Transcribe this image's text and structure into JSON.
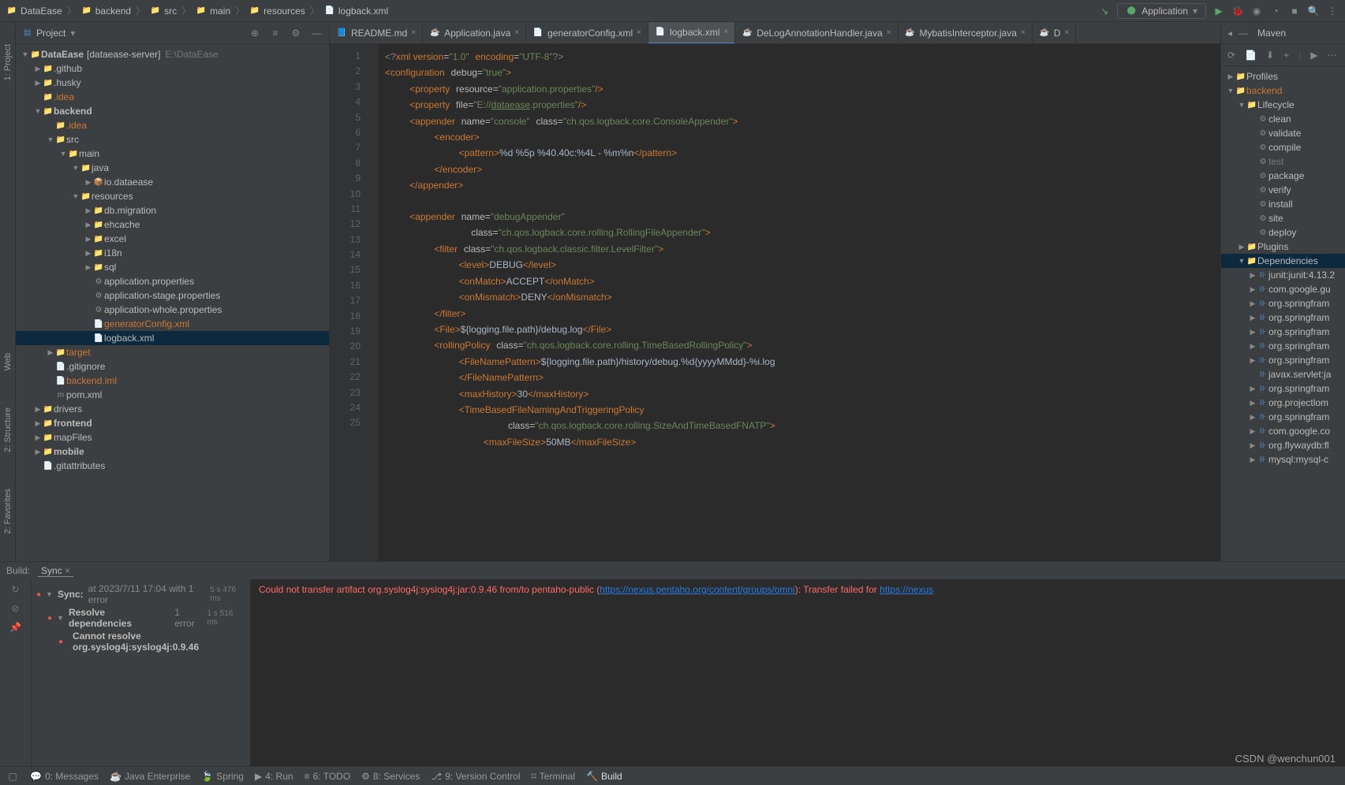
{
  "breadcrumb": [
    "DataEase",
    "backend",
    "src",
    "main",
    "resources",
    "logback.xml"
  ],
  "run_config": "Application",
  "project_panel_title": "Project",
  "project_root": {
    "name": "DataEase",
    "module": "[dataease-server]",
    "path": "E:\\DataEase"
  },
  "tree": [
    {
      "d": 1,
      "a": "▶",
      "i": "📁",
      "t": ".github"
    },
    {
      "d": 1,
      "a": "▶",
      "i": "📁",
      "t": ".husky"
    },
    {
      "d": 1,
      "a": "",
      "i": "📁",
      "t": ".idea",
      "cls": "orange"
    },
    {
      "d": 1,
      "a": "▼",
      "i": "📁",
      "t": "backend",
      "bold": true
    },
    {
      "d": 2,
      "a": "",
      "i": "📁",
      "t": ".idea",
      "cls": "orange"
    },
    {
      "d": 2,
      "a": "▼",
      "i": "📁",
      "t": "src",
      "blue": true
    },
    {
      "d": 3,
      "a": "▼",
      "i": "📁",
      "t": "main"
    },
    {
      "d": 4,
      "a": "▼",
      "i": "📁",
      "t": "java",
      "blue": true
    },
    {
      "d": 5,
      "a": "▶",
      "i": "📦",
      "t": "io.dataease"
    },
    {
      "d": 4,
      "a": "▼",
      "i": "📁",
      "t": "resources"
    },
    {
      "d": 5,
      "a": "▶",
      "i": "📁",
      "t": "db.migration"
    },
    {
      "d": 5,
      "a": "▶",
      "i": "📁",
      "t": "ehcache"
    },
    {
      "d": 5,
      "a": "▶",
      "i": "📁",
      "t": "excel"
    },
    {
      "d": 5,
      "a": "▶",
      "i": "📁",
      "t": "i18n"
    },
    {
      "d": 5,
      "a": "▶",
      "i": "📁",
      "t": "sql"
    },
    {
      "d": 5,
      "a": "",
      "i": "⚙",
      "t": "application.properties"
    },
    {
      "d": 5,
      "a": "",
      "i": "⚙",
      "t": "application-stage.properties"
    },
    {
      "d": 5,
      "a": "",
      "i": "⚙",
      "t": "application-whole.properties"
    },
    {
      "d": 5,
      "a": "",
      "i": "📄",
      "t": "generatorConfig.xml",
      "cls": "orange"
    },
    {
      "d": 5,
      "a": "",
      "i": "📄",
      "t": "logback.xml",
      "sel": true
    },
    {
      "d": 2,
      "a": "▶",
      "i": "📁",
      "t": "target",
      "cls": "orange",
      "orange": true
    },
    {
      "d": 2,
      "a": "",
      "i": "📄",
      "t": ".gitignore"
    },
    {
      "d": 2,
      "a": "",
      "i": "📄",
      "t": "backend.iml",
      "cls": "orange"
    },
    {
      "d": 2,
      "a": "",
      "i": "m",
      "t": "pom.xml"
    },
    {
      "d": 1,
      "a": "▶",
      "i": "📁",
      "t": "drivers"
    },
    {
      "d": 1,
      "a": "▶",
      "i": "📁",
      "t": "frontend",
      "bold": true
    },
    {
      "d": 1,
      "a": "▶",
      "i": "📁",
      "t": "mapFiles"
    },
    {
      "d": 1,
      "a": "▶",
      "i": "📁",
      "t": "mobile",
      "bold": true
    },
    {
      "d": 1,
      "a": "",
      "i": "📄",
      "t": ".gitattributes"
    }
  ],
  "editor_tabs": [
    {
      "icon": "📘",
      "label": "README.md"
    },
    {
      "icon": "☕",
      "label": "Application.java"
    },
    {
      "icon": "📄",
      "label": "generatorConfig.xml"
    },
    {
      "icon": "📄",
      "label": "logback.xml",
      "active": true
    },
    {
      "icon": "☕",
      "label": "DeLogAnnotationHandler.java"
    },
    {
      "icon": "☕",
      "label": "MybatisInterceptor.java"
    },
    {
      "icon": "☕",
      "label": "D"
    }
  ],
  "code_lines": 25,
  "maven_title": "Maven",
  "maven_tree": [
    {
      "d": 0,
      "a": "▶",
      "t": "Profiles"
    },
    {
      "d": 0,
      "a": "▼",
      "t": "backend",
      "cls": "orange"
    },
    {
      "d": 1,
      "a": "▼",
      "t": "Lifecycle"
    },
    {
      "d": 2,
      "a": "",
      "t": "clean",
      "g": true
    },
    {
      "d": 2,
      "a": "",
      "t": "validate",
      "g": true
    },
    {
      "d": 2,
      "a": "",
      "t": "compile",
      "g": true
    },
    {
      "d": 2,
      "a": "",
      "t": "test",
      "g": true,
      "dim": true
    },
    {
      "d": 2,
      "a": "",
      "t": "package",
      "g": true
    },
    {
      "d": 2,
      "a": "",
      "t": "verify",
      "g": true
    },
    {
      "d": 2,
      "a": "",
      "t": "install",
      "g": true
    },
    {
      "d": 2,
      "a": "",
      "t": "site",
      "g": true
    },
    {
      "d": 2,
      "a": "",
      "t": "deploy",
      "g": true
    },
    {
      "d": 1,
      "a": "▶",
      "t": "Plugins"
    },
    {
      "d": 1,
      "a": "▼",
      "t": "Dependencies",
      "sel": true
    },
    {
      "d": 2,
      "a": "▶",
      "t": "junit:junit:4.13.2",
      "lib": true
    },
    {
      "d": 2,
      "a": "▶",
      "t": "com.google.gu",
      "lib": true
    },
    {
      "d": 2,
      "a": "▶",
      "t": "org.springfram",
      "lib": true
    },
    {
      "d": 2,
      "a": "▶",
      "t": "org.springfram",
      "lib": true
    },
    {
      "d": 2,
      "a": "▶",
      "t": "org.springfram",
      "lib": true
    },
    {
      "d": 2,
      "a": "▶",
      "t": "org.springfram",
      "lib": true
    },
    {
      "d": 2,
      "a": "▶",
      "t": "org.springfram",
      "lib": true
    },
    {
      "d": 2,
      "a": "",
      "t": "javax.servlet:ja",
      "lib": true
    },
    {
      "d": 2,
      "a": "▶",
      "t": "org.springfram",
      "lib": true
    },
    {
      "d": 2,
      "a": "▶",
      "t": "org.projectlom",
      "lib": true
    },
    {
      "d": 2,
      "a": "▶",
      "t": "org.springfram",
      "lib": true
    },
    {
      "d": 2,
      "a": "▶",
      "t": "com.google.co",
      "lib": true
    },
    {
      "d": 2,
      "a": "▶",
      "t": "org.flywaydb:fl",
      "lib": true
    },
    {
      "d": 2,
      "a": "▶",
      "t": "mysql:mysql-c",
      "lib": true
    }
  ],
  "build_tab_label": "Build:",
  "build_sync_tab": "Sync",
  "build_tree": [
    {
      "d": 0,
      "ic": "err",
      "t": "Sync:",
      "sub": "at 2023/7/11 17:04 with 1 error",
      "time": "5 s 476 ms"
    },
    {
      "d": 1,
      "ic": "err",
      "t": "Resolve dependencies",
      "sub": "1 error",
      "time": "1 s 516 ms"
    },
    {
      "d": 2,
      "ic": "err",
      "t": "Cannot resolve org.syslog4j:syslog4j:0.9.46"
    }
  ],
  "build_msg_pre": "Could not transfer artifact org.syslog4j:syslog4j:jar:0.9.46 from/to pentaho-public (",
  "build_msg_link1": "https://nexus.pentaho.org/content/groups/omni",
  "build_msg_mid": "): Transfer failed for ",
  "build_msg_link2": "https://nexus",
  "status_items": [
    {
      "i": "💬",
      "t": "0: Messages"
    },
    {
      "i": "☕",
      "t": "Java Enterprise"
    },
    {
      "i": "🍃",
      "t": "Spring"
    },
    {
      "i": "▶",
      "t": "4: Run"
    },
    {
      "i": "≡",
      "t": "6: TODO"
    },
    {
      "i": "⚙",
      "t": "8: Services"
    },
    {
      "i": "⎇",
      "t": "9: Version Control"
    },
    {
      "i": "⌑",
      "t": "Terminal"
    },
    {
      "i": "🔨",
      "t": "Build",
      "active": true
    }
  ],
  "watermark": "CSDN @wenchun001",
  "left_vtabs": [
    "1: Project",
    "Web",
    "2: Structure",
    "2: Favorites"
  ]
}
